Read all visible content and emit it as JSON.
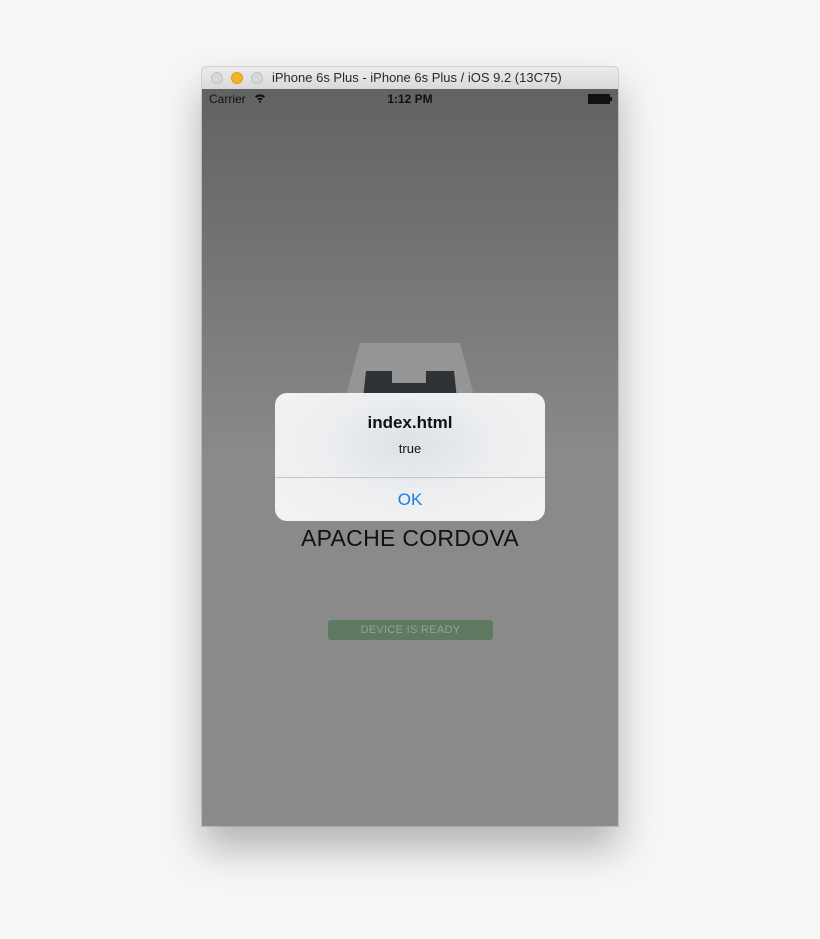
{
  "window": {
    "title": "iPhone 6s Plus - iPhone 6s Plus / iOS 9.2 (13C75)"
  },
  "statusbar": {
    "carrier": "Carrier",
    "time": "1:12 PM",
    "wifi_icon": "wifi-icon",
    "battery_icon": "battery-icon"
  },
  "app": {
    "title": "APACHE CORDOVA",
    "status_badge": "DEVICE IS READY",
    "badge_color": "#5f7a62",
    "logo_icon": "cordova-logo"
  },
  "alert": {
    "title": "index.html",
    "message": "true",
    "button_label": "OK",
    "button_color": "#1a7ce8"
  }
}
